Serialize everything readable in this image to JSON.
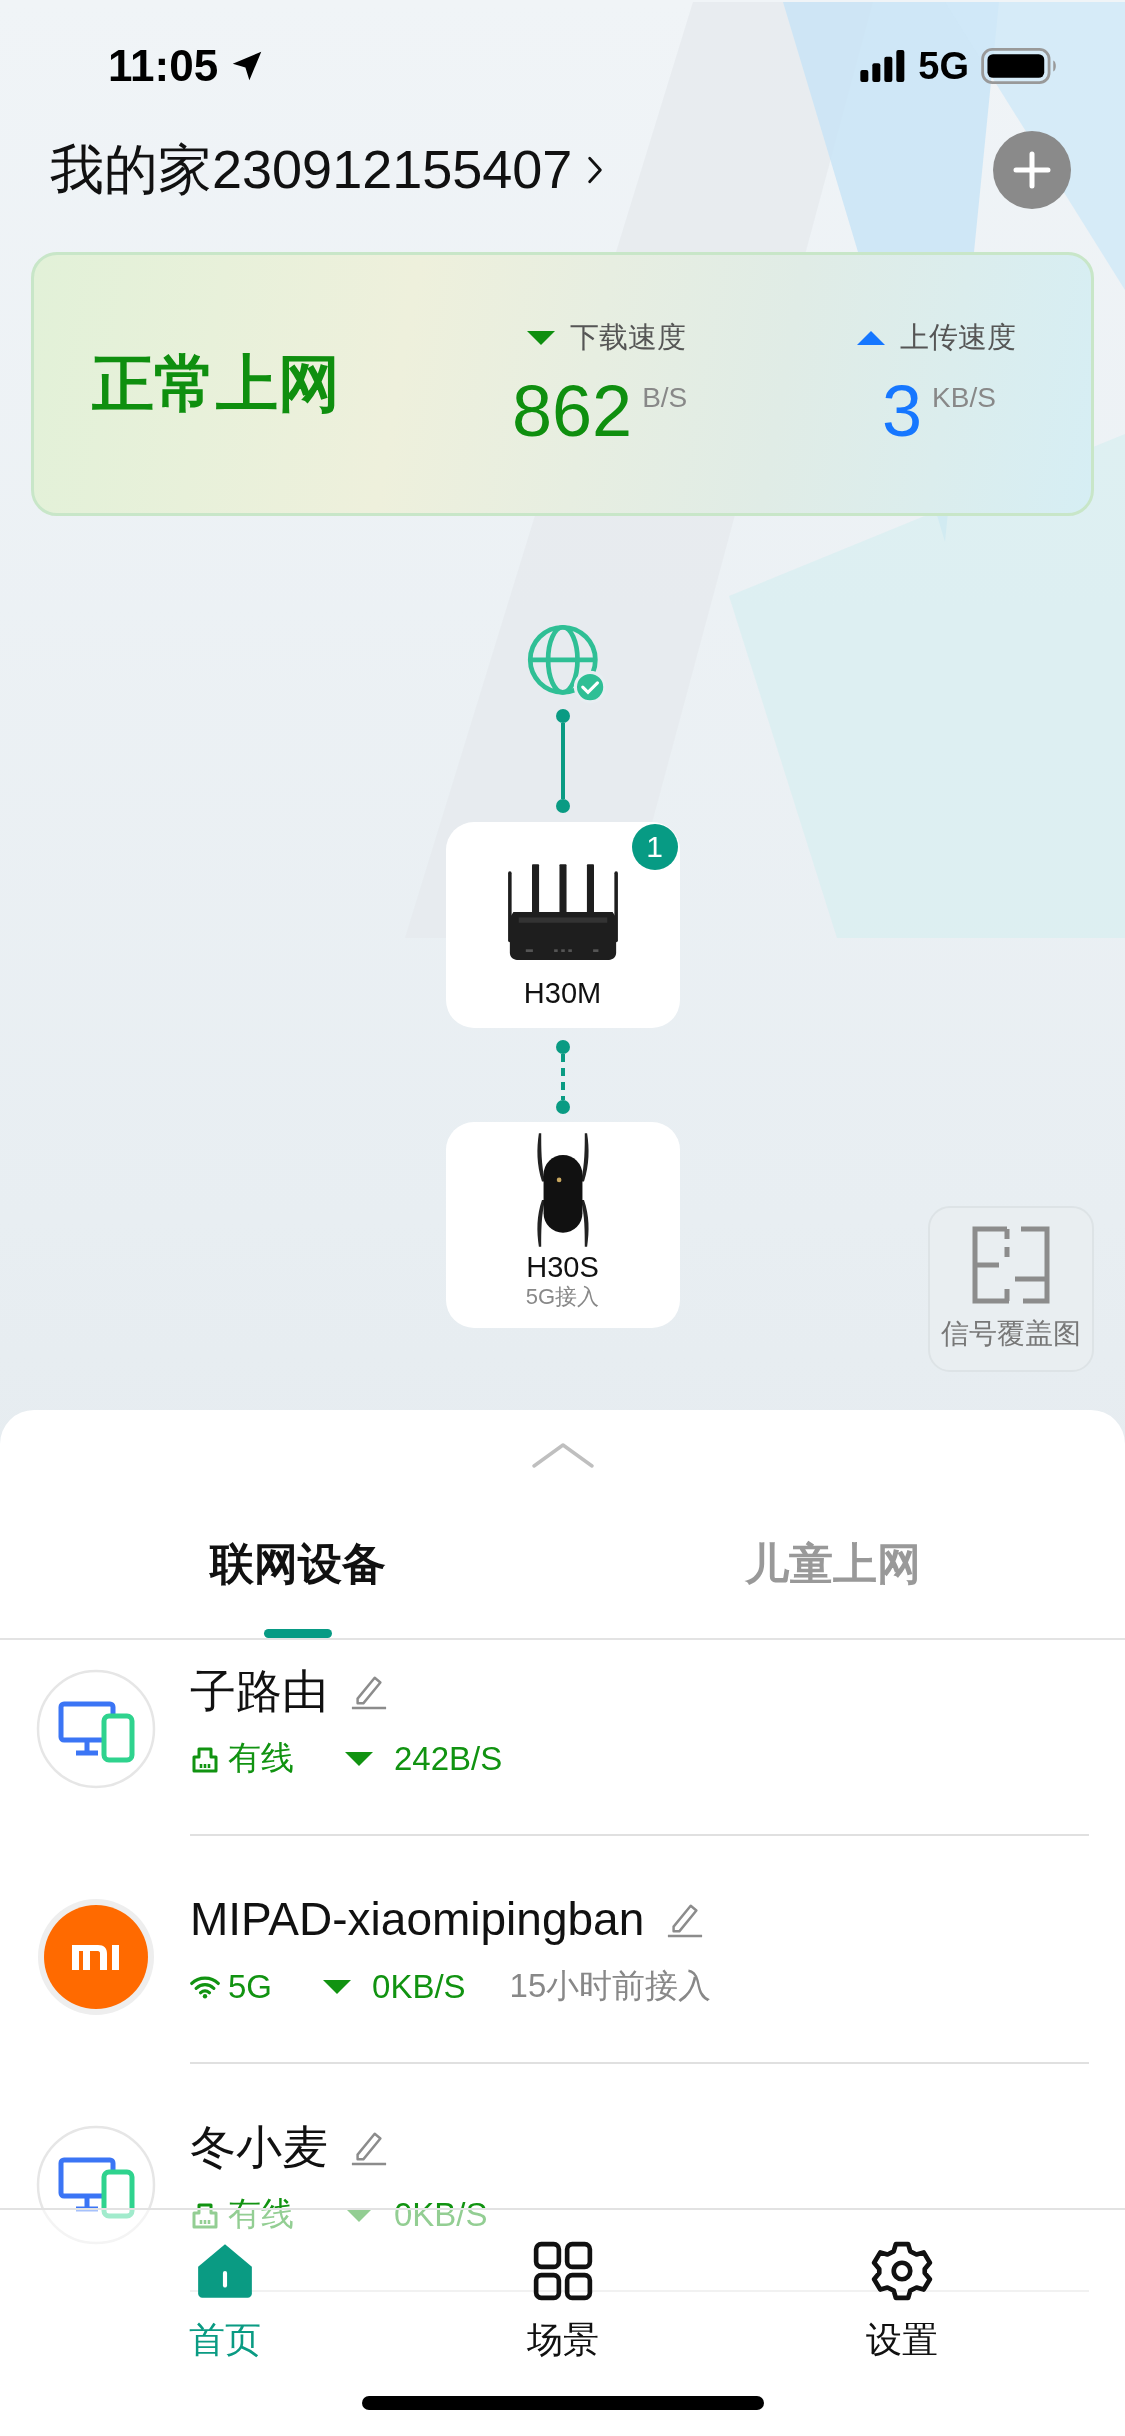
{
  "status_bar": {
    "time": "11:05",
    "network": "5G"
  },
  "home": {
    "title": "我的家230912155407"
  },
  "network_status": {
    "state": "正常上网",
    "download": {
      "label": "下载速度",
      "value": "862",
      "unit": "B/S"
    },
    "upload": {
      "label": "上传速度",
      "value": "3",
      "unit": "KB/S"
    }
  },
  "topology": {
    "internet_connected": true,
    "nodes": [
      {
        "name": "H30M",
        "kind": "router",
        "badge": "1"
      },
      {
        "name": "H30S",
        "kind": "extender",
        "subtitle": "5G接入"
      }
    ]
  },
  "coverage_button": {
    "label": "信号覆盖图"
  },
  "tabs": [
    {
      "label": "联网设备",
      "selected": true
    },
    {
      "label": "儿童上网",
      "selected": false
    }
  ],
  "devices": [
    {
      "name": "子路由",
      "kind": "computer",
      "connection": {
        "kind": "wired",
        "label": "有线"
      },
      "speed": "242B/S"
    },
    {
      "name": "MIPAD-xiaomipingban",
      "kind": "xiaomi",
      "connection": {
        "kind": "wifi",
        "label": "5G"
      },
      "speed": "0KB/S",
      "joined": "15小时前接入"
    },
    {
      "name": "冬小麦",
      "kind": "computer",
      "connection": {
        "kind": "wired",
        "label": "有线"
      },
      "speed": "0KB/S"
    }
  ],
  "nav": [
    {
      "label": "首页",
      "selected": true
    },
    {
      "label": "场景",
      "selected": false
    },
    {
      "label": "设置",
      "selected": false
    }
  ]
}
